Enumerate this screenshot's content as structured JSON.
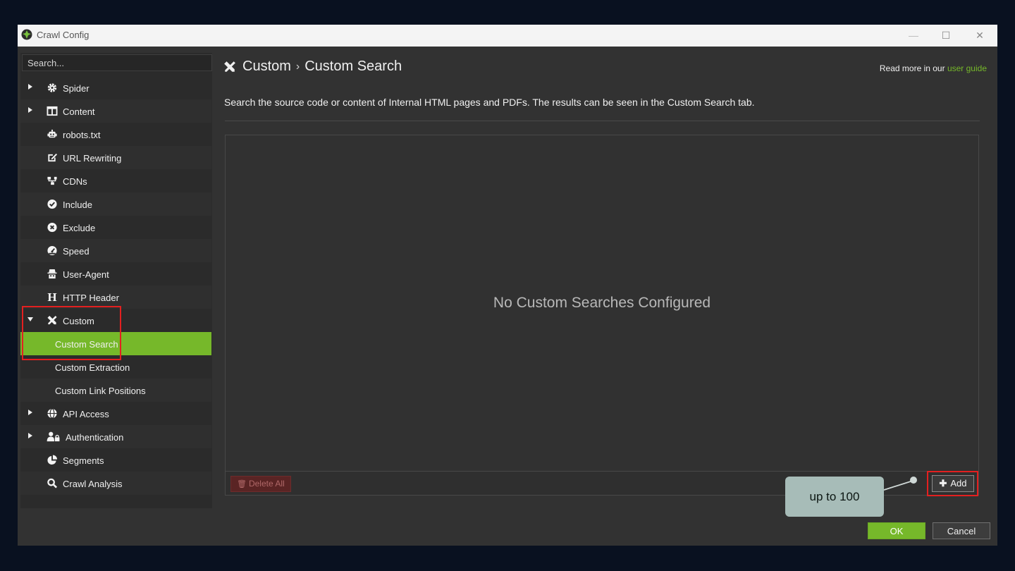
{
  "window": {
    "title": "Crawl Config",
    "controls": {
      "minimize": "—",
      "maximize": "☐",
      "close": "✕"
    }
  },
  "sidebar": {
    "search_placeholder": "Search...",
    "items": [
      {
        "label": "Spider",
        "icon": "gear-icon",
        "arrow": "right"
      },
      {
        "label": "Content",
        "icon": "columns-icon",
        "arrow": "right"
      },
      {
        "label": "robots.txt",
        "icon": "robot-icon"
      },
      {
        "label": "URL Rewriting",
        "icon": "edit-icon"
      },
      {
        "label": "CDNs",
        "icon": "network-icon"
      },
      {
        "label": "Include",
        "icon": "check-circle-icon"
      },
      {
        "label": "Exclude",
        "icon": "x-circle-icon"
      },
      {
        "label": "Speed",
        "icon": "speedometer-icon"
      },
      {
        "label": "User-Agent",
        "icon": "user-secret-icon"
      },
      {
        "label": "HTTP Header",
        "icon": "header-icon"
      },
      {
        "label": "Custom",
        "icon": "tools-icon",
        "arrow": "down"
      },
      {
        "label": "Custom Search",
        "sub": true,
        "active": true
      },
      {
        "label": "Custom Extraction",
        "sub": true
      },
      {
        "label": "Custom Link Positions",
        "sub": true
      },
      {
        "label": "API Access",
        "icon": "globe-icon",
        "arrow": "right"
      },
      {
        "label": "Authentication",
        "icon": "user-lock-icon",
        "arrow": "right"
      },
      {
        "label": "Segments",
        "icon": "pie-chart-icon"
      },
      {
        "label": "Crawl Analysis",
        "icon": "search-icon"
      }
    ]
  },
  "header": {
    "crumb_root": "Custom",
    "crumb_sep": "›",
    "crumb_current": "Custom Search",
    "readmore_prefix": "Read more in our",
    "readmore_link": "user guide"
  },
  "description": "Search the source code or content of Internal HTML pages and PDFs. The results can be seen in the Custom Search tab.",
  "panel": {
    "empty_message": "No Custom Searches Configured",
    "delete_all_label": "Delete All",
    "add_label": "Add"
  },
  "callout": {
    "text": "up to 100"
  },
  "footer": {
    "ok_label": "OK",
    "cancel_label": "Cancel"
  },
  "colors": {
    "accent": "#76b82a",
    "highlight_box": "#e32020",
    "callout_bg": "#a7bcb8",
    "backdrop": "#091120"
  }
}
